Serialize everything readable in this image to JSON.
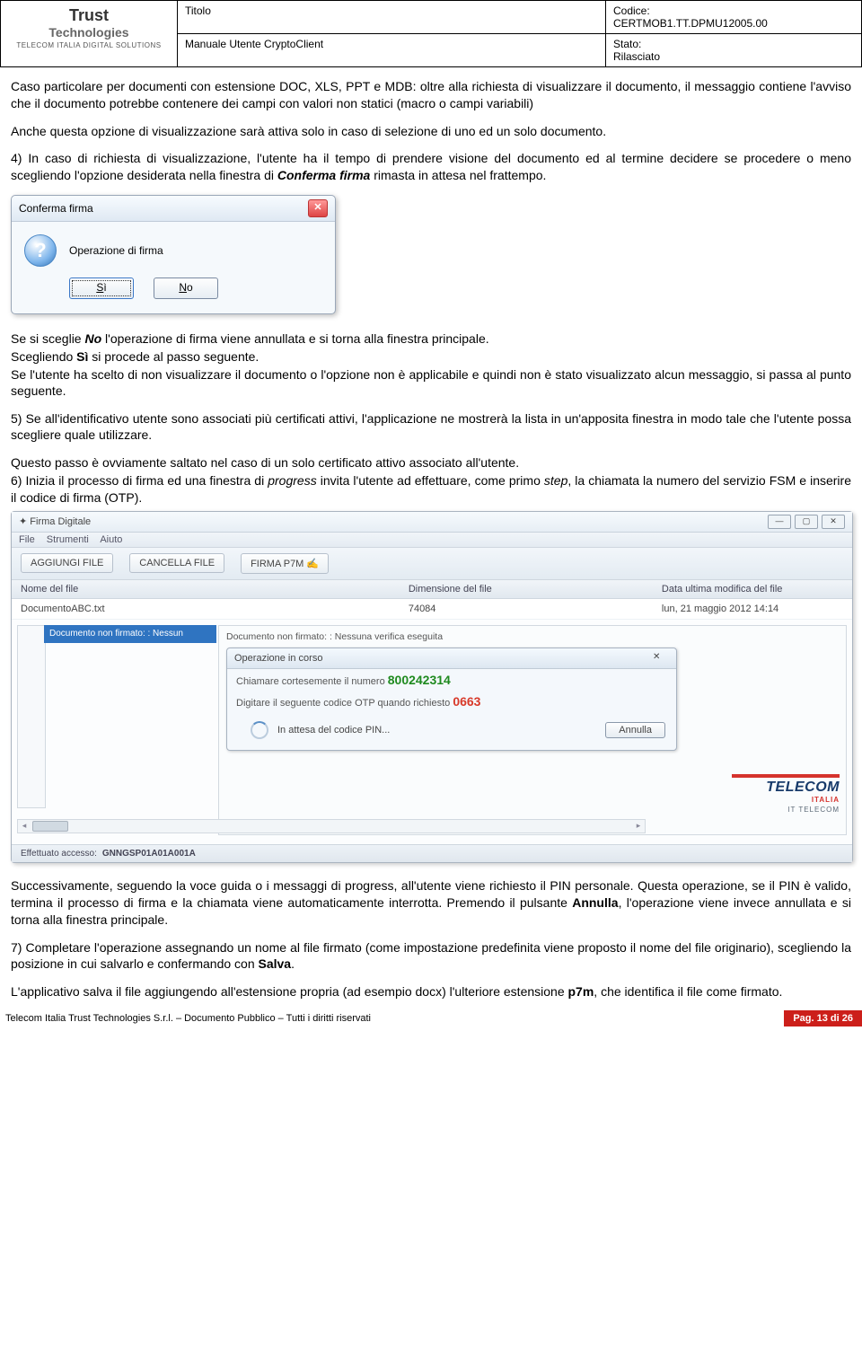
{
  "hdr": {
    "logo_name": "Trust",
    "logo_sub": "Technologies",
    "logo_tag": "TELECOM ITALIA DIGITAL SOLUTIONS",
    "titolo_lbl": "Titolo",
    "manuale": "Manuale Utente CryptoClient",
    "codice_lbl": "Codice:",
    "codice_val": "CERTMOB1.TT.DPMU12005.00",
    "stato_lbl": "Stato:",
    "stato_val": "Rilasciato"
  },
  "para": {
    "p1": "Caso particolare per documenti con estensione DOC, XLS, PPT e MDB: oltre alla richiesta di visualizzare il documento, il messaggio contiene l'avviso che il documento potrebbe contenere dei campi con valori non statici (macro o campi variabili)",
    "p2": "Anche questa opzione di visualizzazione sarà attiva solo in caso di selezione di uno ed un solo documento.",
    "p3a": "4) In caso di richiesta di visualizzazione, l'utente ha il tempo di prendere visione del documento ed al termine decidere se procedere o meno scegliendo l'opzione desiderata nella finestra di ",
    "p3b": "Conferma firma",
    "p3c": " rimasta in attesa nel frattempo.",
    "p4a": "Se si sceglie ",
    "p4b": "No",
    "p4c": " l'operazione di firma viene annullata e si torna alla finestra principale.",
    "p5a": "Scegliendo ",
    "p5b": "Sì",
    "p5c": " si procede al passo seguente.",
    "p6": "Se l'utente ha scelto di non visualizzare il documento o l'opzione non è applicabile e quindi non è stato visualizzato alcun messaggio, si passa al punto seguente.",
    "p7": "5) Se all'identificativo utente sono associati più certificati attivi, l'applicazione ne mostrerà la lista in un'apposita finestra in modo tale che l'utente possa scegliere quale utilizzare.",
    "p8": "Questo passo è ovviamente saltato nel caso di un solo certificato attivo associato all'utente.",
    "p9a": "6) Inizia il processo di firma ed una finestra di ",
    "p9b": "progress",
    "p9c": " invita l'utente ad effettuare, come primo ",
    "p9d": "step",
    "p9e": ", la chiamata la numero del servizio FSM e inserire il codice di firma (OTP).",
    "p10": "Successivamente, seguendo la voce guida o i messaggi di progress, all'utente viene richiesto il PIN personale. Questa operazione, se il PIN è valido, termina il processo di firma e la chiamata viene automaticamente interrotta. Premendo il pulsante ",
    "p10b": "Annulla",
    "p10c": ", l'operazione viene invece annullata e si torna alla finestra principale.",
    "p11a": "7) Completare l'operazione assegnando un nome al file firmato (come impostazione predefinita viene proposto il nome del file originario), scegliendo la posizione in cui salvarlo e confermando con ",
    "p11b": "Salva",
    "p11c": ".",
    "p12a": "L'applicativo salva il file aggiungendo all'estensione propria (ad esempio docx) l'ulteriore estensione ",
    "p12b": "p7m",
    "p12c": ", che identifica il file come firmato."
  },
  "dlg1": {
    "title": "Conferma firma",
    "msg": "Operazione di firma",
    "yes": "Sì",
    "no": "No"
  },
  "app": {
    "title": "Firma Digitale",
    "menu": {
      "file": "File",
      "strumenti": "Strumenti",
      "aiuto": "Aiuto"
    },
    "tool": {
      "aggiungi": "AGGIUNGI FILE",
      "cancella": "CANCELLA FILE",
      "firma": "FIRMA P7M"
    },
    "cols": {
      "c1": "Nome del file",
      "c2": "Dimensione del file",
      "c3": "Data ultima modifica del file"
    },
    "row": {
      "name": "DocumentoABC.txt",
      "size": "74084",
      "date": "lun, 21 maggio 2012 14:14"
    },
    "bluebar": "Documento non firmato:  : Nessun",
    "rpane_msg": "Documento non firmato:  : Nessuna verifica eseguita",
    "inner": {
      "title": "Operazione in corso",
      "line1a": "Chiamare cortesemente il numero ",
      "line1b": "800242314",
      "line2a": "Digitare il seguente codice OTP quando richiesto ",
      "line2b": "0663",
      "progress": "In attesa del codice PIN...",
      "annulla": "Annulla"
    },
    "telecom": {
      "word": "TELECOM",
      "italia": "ITALIA",
      "sub": "IT  TELECOM"
    },
    "status_lbl": "Effettuato accesso:",
    "status_user": "GNNGSP01A01A001A"
  },
  "foot": {
    "left": "Telecom Italia Trust Technologies S.r.l. – Documento Pubblico – Tutti i diritti riservati",
    "right": "Pag. 13 di 26"
  }
}
